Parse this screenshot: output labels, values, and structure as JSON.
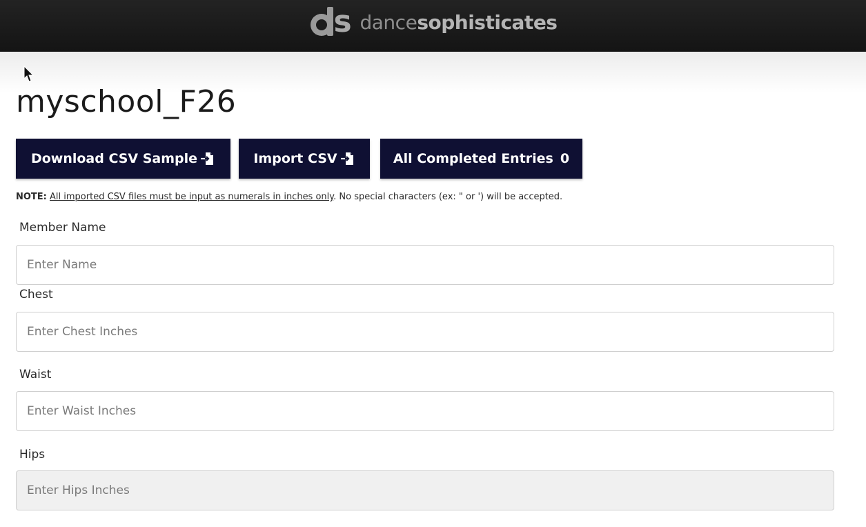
{
  "header": {
    "logo_text_light": "dance",
    "logo_text_bold": "sophisticates"
  },
  "page": {
    "title": "myschool_F26"
  },
  "toolbar": {
    "download_label": "Download CSV Sample",
    "import_label": "Import CSV",
    "entries_label": "All Completed Entries",
    "entries_count": "0"
  },
  "note": {
    "label": "NOTE:",
    "underlined": "All imported CSV files must be input as numerals in inches only",
    "rest": ". No special characters (ex: \" or ') will be accepted."
  },
  "form": {
    "name_label": "Member Name",
    "name_placeholder": "Enter Name",
    "chest_label": "Chest",
    "chest_placeholder": "Enter Chest Inches",
    "waist_label": "Waist",
    "waist_placeholder": "Enter Waist Inches",
    "hips_label": "Hips",
    "hips_placeholder": "Enter Hips Inches"
  },
  "icons": {
    "logo": "ds-logo-icon",
    "file_import": "file-import-icon",
    "cursor": "mouse-cursor-icon"
  }
}
